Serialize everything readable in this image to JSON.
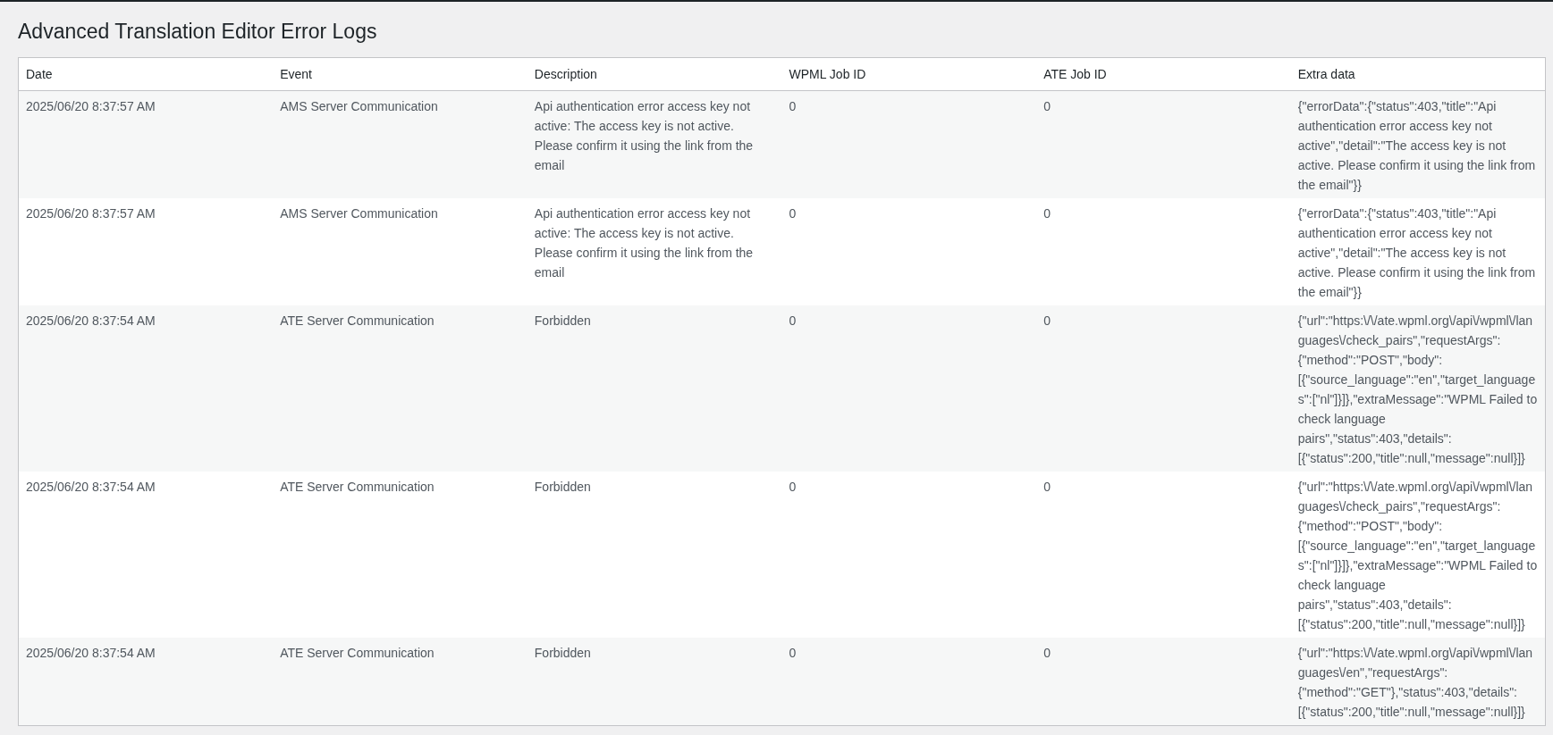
{
  "title": "Advanced Translation Editor Error Logs",
  "table": {
    "columns": [
      "Date",
      "Event",
      "Description",
      "WPML Job ID",
      "ATE Job ID",
      "Extra data"
    ],
    "rows": [
      [
        "2025/06/20 8:37:57 AM",
        "AMS Server Communication",
        "Api authentication error access key not active: The access key is not active. Please confirm it using the link from the email",
        "0",
        "0",
        "{\"errorData\":{\"status\":403,\"title\":\"Api authentication error access key not active\",\"detail\":\"The access key is not active. Please confirm it using the link from the email\"}}"
      ],
      [
        "2025/06/20 8:37:57 AM",
        "AMS Server Communication",
        "Api authentication error access key not active: The access key is not active. Please confirm it using the link from the email",
        "0",
        "0",
        "{\"errorData\":{\"status\":403,\"title\":\"Api authentication error access key not active\",\"detail\":\"The access key is not active. Please confirm it using the link from the email\"}}"
      ],
      [
        "2025/06/20 8:37:54 AM",
        "ATE Server Communication",
        "Forbidden",
        "0",
        "0",
        "{\"url\":\"https:\\/\\/ate.wpml.org\\/api\\/wpml\\/languages\\/check_pairs\",\"requestArgs\":{\"method\":\"POST\",\"body\":[{\"source_language\":\"en\",\"target_languages\":[\"nl\"]}]},\"extraMessage\":\"WPML Failed to check language pairs\",\"status\":403,\"details\":[{\"status\":200,\"title\":null,\"message\":null}]}"
      ],
      [
        "2025/06/20 8:37:54 AM",
        "ATE Server Communication",
        "Forbidden",
        "0",
        "0",
        "{\"url\":\"https:\\/\\/ate.wpml.org\\/api\\/wpml\\/languages\\/check_pairs\",\"requestArgs\":{\"method\":\"POST\",\"body\":[{\"source_language\":\"en\",\"target_languages\":[\"nl\"]}]},\"extraMessage\":\"WPML Failed to check language pairs\",\"status\":403,\"details\":[{\"status\":200,\"title\":null,\"message\":null}]}"
      ],
      [
        "2025/06/20 8:37:54 AM",
        "ATE Server Communication",
        "Forbidden",
        "0",
        "0",
        "{\"url\":\"https:\\/\\/ate.wpml.org\\/api\\/wpml\\/languages\\/en\",\"requestArgs\":{\"method\":\"GET\"},\"status\":403,\"details\":[{\"status\":200,\"title\":null,\"message\":null}]}"
      ]
    ]
  }
}
